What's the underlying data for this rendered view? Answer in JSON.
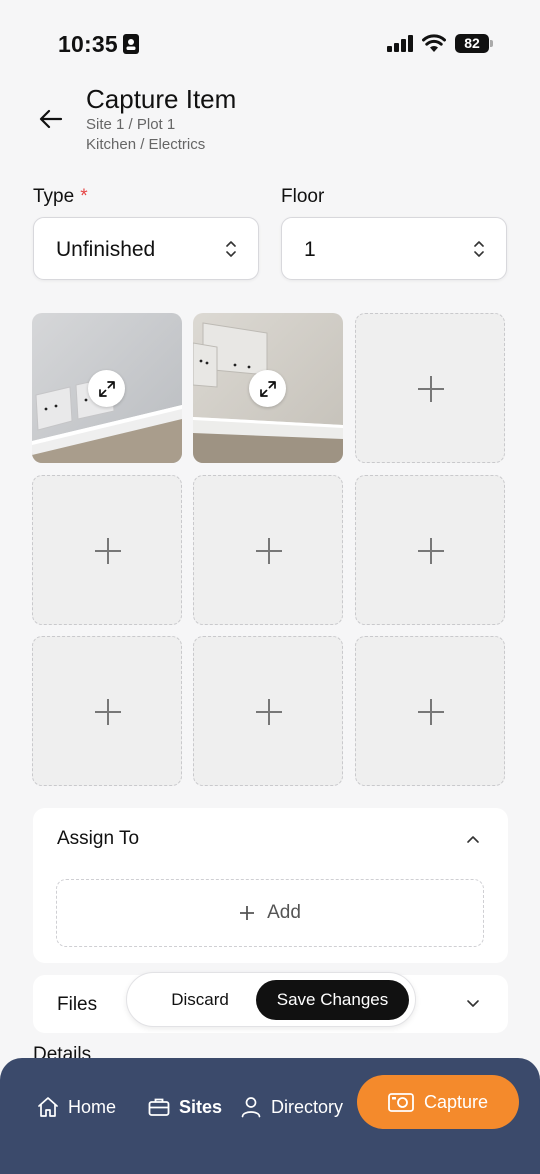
{
  "status_bar": {
    "time": "10:35",
    "battery": "82"
  },
  "header": {
    "title": "Capture Item",
    "breadcrumb_1": "Site 1 / Plot 1",
    "breadcrumb_2": "Kitchen / Electrics"
  },
  "form": {
    "type_label": "Type",
    "required_mark": "*",
    "type_value": "Unfinished",
    "floor_label": "Floor",
    "floor_value": "1"
  },
  "photos": {
    "filled_count": 2,
    "total_slots": 9
  },
  "assign": {
    "title": "Assign To",
    "add_label": "Add"
  },
  "files": {
    "title": "Files"
  },
  "details": {
    "title": "Details"
  },
  "actions": {
    "discard_label": "Discard",
    "save_label": "Save Changes"
  },
  "nav": {
    "home": "Home",
    "sites": "Sites",
    "directory": "Directory",
    "capture": "Capture"
  },
  "colors": {
    "accent": "#f48a2c",
    "nav_background": "#3b4a6b",
    "required": "#e54545"
  }
}
